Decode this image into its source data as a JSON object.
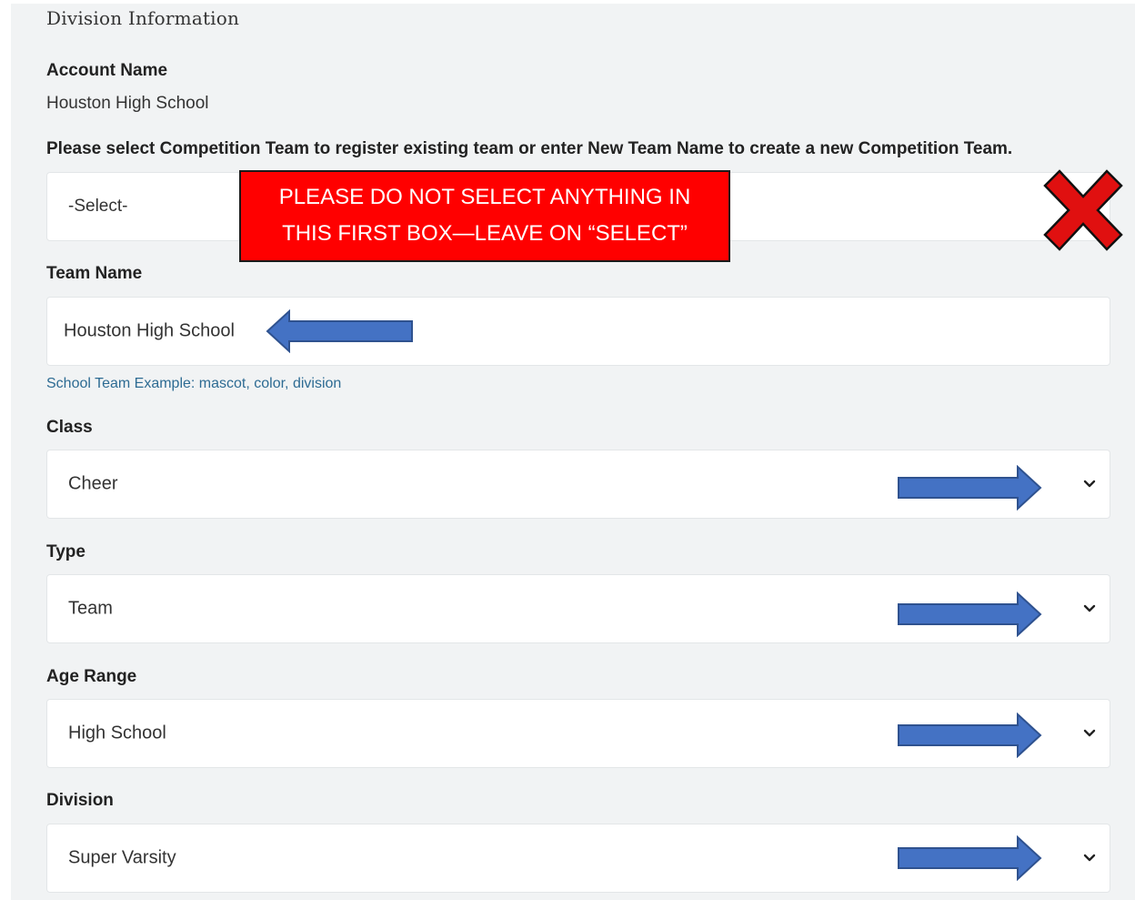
{
  "section_title": "Division Information",
  "account": {
    "label": "Account Name",
    "value": "Houston High School"
  },
  "competition_team": {
    "label": "Please select Competition Team to register existing team or enter New Team Name to create a new Competition Team.",
    "value": "-Select-"
  },
  "annotation": {
    "line1": "PLEASE DO NOT SELECT ANYTHING IN",
    "line2": "THIS FIRST BOX—LEAVE ON “SELECT”",
    "box_color": "#ff0000",
    "arrow_color": "#4472c4",
    "x_mark_color": "#e01010"
  },
  "team_name": {
    "label": "Team Name",
    "value": "Houston High School",
    "hint": "School Team Example: mascot, color, division"
  },
  "class": {
    "label": "Class",
    "value": "Cheer"
  },
  "type": {
    "label": "Type",
    "value": "Team"
  },
  "age_range": {
    "label": "Age Range",
    "value": "High School"
  },
  "division": {
    "label": "Division",
    "value": "Super Varsity"
  },
  "icons": {
    "dropdown": "chevron-down-icon",
    "reject": "x-mark-icon",
    "pointer": "arrow-icon"
  }
}
